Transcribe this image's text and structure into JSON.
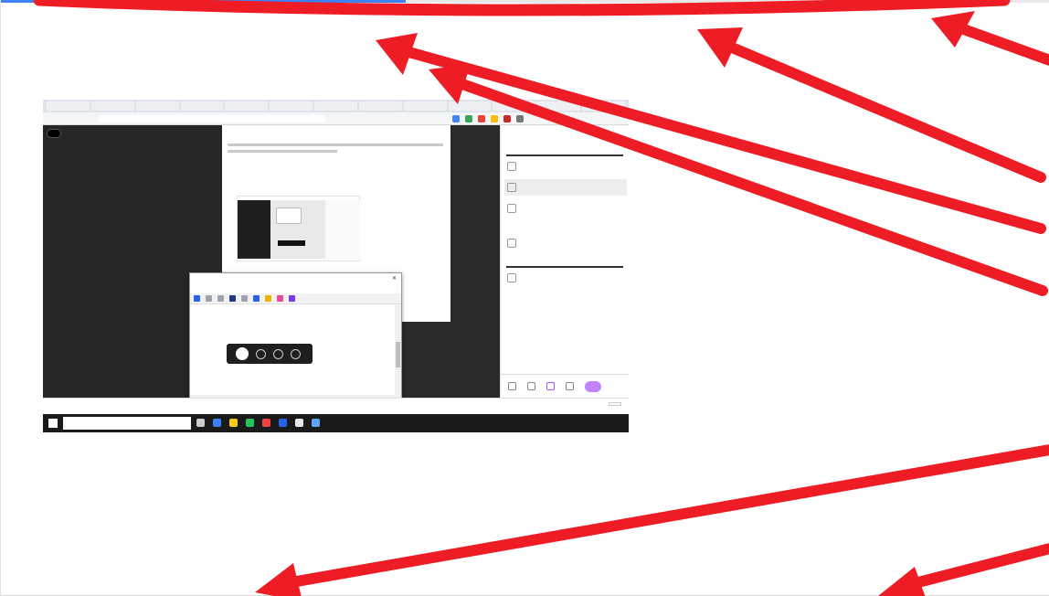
{
  "progress": {
    "fraction": 0.386,
    "color": "#3b82f6"
  },
  "annotation": {
    "arrow_color": "#ee1c24",
    "count": 7
  },
  "screenshot": {
    "browser_tabs": [
      "",
      "",
      "",
      "",
      "",
      "",
      "",
      "",
      "",
      "",
      "",
      "",
      ""
    ],
    "address": "",
    "document": {
      "title": "",
      "links": [
        "",
        "",
        ""
      ]
    },
    "side_panel": {
      "title": "",
      "sections": [
        {
          "heading": "",
          "items": [
            "",
            ""
          ]
        },
        {
          "heading": "",
          "items": [
            "",
            ""
          ]
        },
        {
          "heading": "",
          "items": [
            ""
          ]
        }
      ]
    },
    "snip_window": {
      "title": "",
      "subtitle": ""
    },
    "download_bar": {
      "item": "",
      "show_all": ""
    },
    "taskbar": {
      "search_placeholder": "",
      "tray_text": ""
    }
  }
}
